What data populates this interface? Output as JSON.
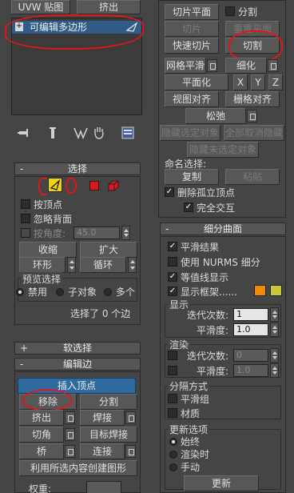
{
  "top_tabs": {
    "uvw": "UVW 贴图",
    "collapse": "挤出"
  },
  "modifier_stack": {
    "item_label": "可编辑多边形",
    "expand_glyph": "+"
  },
  "stack_tools": [
    "pin-stack-icon",
    "show-end-result-icon",
    "make-unique-icon",
    "remove-modifier-icon",
    "configure-sets-icon"
  ],
  "right_panel": {
    "slice_plane": "切片平面",
    "split": "分割",
    "slice": "切片",
    "reset_plane": "重置平面",
    "quick_slice": "快速切片",
    "cut": "切割",
    "meshsmooth": "网格平滑",
    "tessellate": "细化",
    "planarize": "平面化",
    "x": "X",
    "y": "Y",
    "z": "Z",
    "view_align": "视图对齐",
    "grid_align": "栅格对齐",
    "relax": "松弛",
    "hide_selected": "隐藏选定对象",
    "unhide_all": "全部取消隐藏",
    "hide_unselected": "隐藏未选定对象",
    "named_selections": "命名选择:",
    "copy": "复制",
    "paste": "粘贴",
    "delete_isolated": "删除孤立顶点",
    "full_interactivity": "完全交互"
  },
  "subdivision": {
    "title": "细分曲面",
    "smooth_result": "平滑结果",
    "use_nurms": "使用 NURMS 细分",
    "isoline_display": "等值线显示",
    "show_cage": "显示框架......",
    "cage_color_1": "#f08a00",
    "cage_color_2": "#c8c83a",
    "display_group": "显示",
    "iterations_label": "迭代次数:",
    "iterations_value": "1",
    "smoothness_label": "平滑度:",
    "smoothness_value": "1.0",
    "render_group": "渲染",
    "render_iterations_value": "0",
    "render_smoothness_value": "1.0",
    "separate_by": "分隔方式",
    "smoothing_groups": "平滑组",
    "materials": "材质",
    "update_options": "更新选项",
    "always": "始终",
    "when_rendering": "渲染时",
    "manually": "手动",
    "update": "更新"
  },
  "selection": {
    "title": "选择",
    "by_vertex": "按顶点",
    "ignore_backfacing": "忽略背面",
    "by_angle": "按角度:",
    "angle_value": "45.0",
    "shrink": "收缩",
    "grow": "扩大",
    "ring": "环形",
    "loop": "循环",
    "preview_selection": "预览选择",
    "disabled": "禁用",
    "subobject": "子对象",
    "multi": "多个",
    "status": "选择了 0 个边"
  },
  "soft_selection": {
    "title": "软选择",
    "sign": "+"
  },
  "edit_edges": {
    "title": "编辑边",
    "sign": "-",
    "insert_vertex": "插入顶点",
    "remove": "移除",
    "split": "分割",
    "extrude": "挤出",
    "weld": "焊接",
    "chamfer": "切角",
    "target_weld": "目标焊接",
    "bridge": "桥",
    "connect": "连接",
    "create_shape": "利用所选内容创建图形",
    "weight": "权重:"
  }
}
